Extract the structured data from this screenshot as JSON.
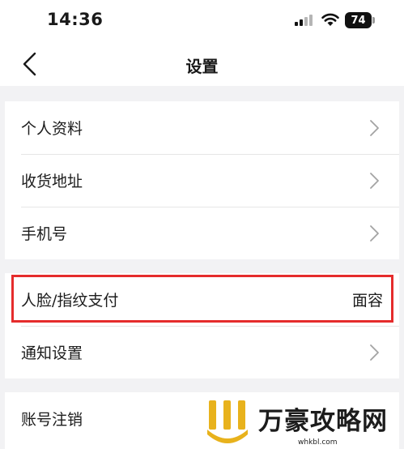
{
  "status_bar": {
    "time": "14:36",
    "battery_level": "74",
    "icons": [
      "signal-icon",
      "wifi-icon",
      "battery-icon"
    ]
  },
  "nav": {
    "title": "设置",
    "back_icon": "chevron-left-icon"
  },
  "groups": [
    {
      "items": [
        {
          "label": "个人资料",
          "icon": "chevron-right-icon"
        },
        {
          "label": "收货地址",
          "icon": "chevron-right-icon"
        },
        {
          "label": "手机号",
          "icon": "chevron-right-icon"
        }
      ]
    },
    {
      "items": [
        {
          "label": "人脸/指纹支付",
          "value": "面容",
          "highlighted": true
        },
        {
          "label": "通知设置",
          "icon": "chevron-right-icon"
        }
      ]
    },
    {
      "items": [
        {
          "label": "账号注销"
        }
      ]
    }
  ],
  "watermark": {
    "name": "万豪攻略网",
    "url": "whkbl.com"
  },
  "colors": {
    "background": "#f2f2f4",
    "highlight_border": "#e52c2c",
    "watermark_gold": "#e8b21c"
  }
}
